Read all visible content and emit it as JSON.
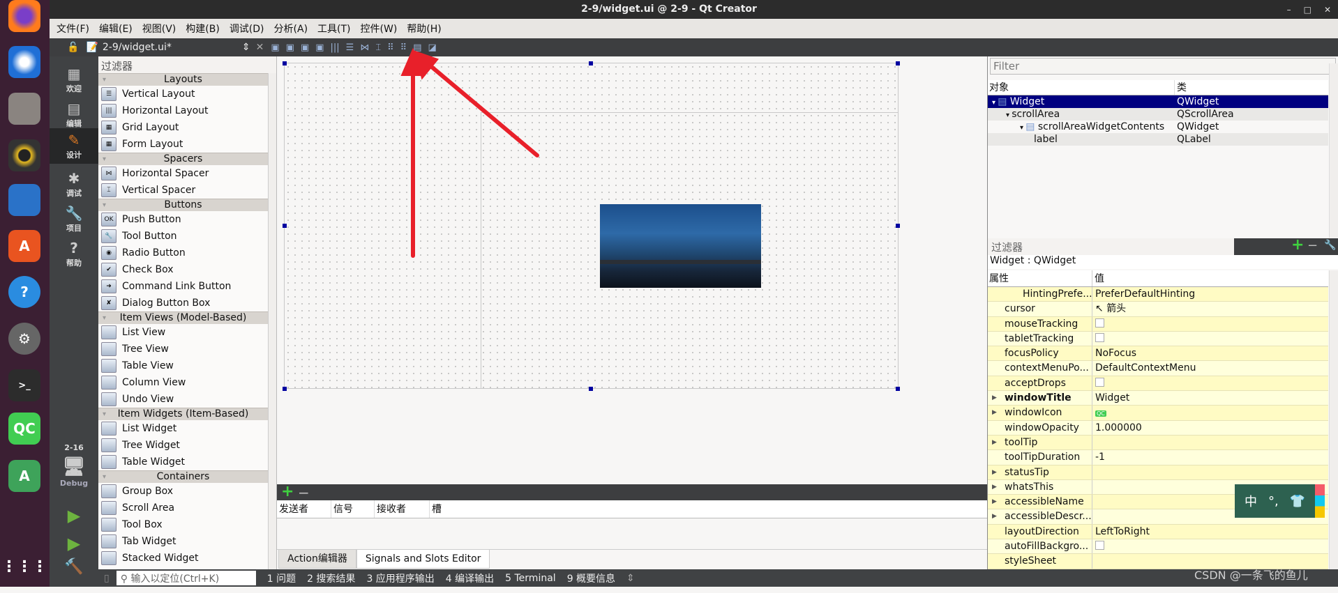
{
  "window": {
    "title": "2-9/widget.ui @ 2-9 - Qt Creator",
    "controls": [
      "–",
      "□",
      "✕"
    ]
  },
  "menu": [
    "文件(F)",
    "编辑(E)",
    "视图(V)",
    "构建(B)",
    "调试(D)",
    "分析(A)",
    "工具(T)",
    "控件(W)",
    "帮助(H)"
  ],
  "toolbar": {
    "file": "2-9/widget.ui*",
    "close": "✕"
  },
  "modes": [
    {
      "label": "欢迎",
      "icon": "▦"
    },
    {
      "label": "编辑",
      "icon": "▤"
    },
    {
      "label": "设计",
      "icon": "✎"
    },
    {
      "label": "调试",
      "icon": "✱"
    },
    {
      "label": "项目",
      "icon": "🔧"
    },
    {
      "label": "帮助",
      "icon": "?"
    }
  ],
  "kit": {
    "project": "2-16",
    "config": "Debug"
  },
  "widgetbox": {
    "filter": "过滤器",
    "categories": [
      {
        "name": "Layouts",
        "items": [
          "Vertical Layout",
          "Horizontal Layout",
          "Grid Layout",
          "Form Layout"
        ]
      },
      {
        "name": "Spacers",
        "items": [
          "Horizontal Spacer",
          "Vertical Spacer"
        ]
      },
      {
        "name": "Buttons",
        "items": [
          "Push Button",
          "Tool Button",
          "Radio Button",
          "Check Box",
          "Command Link Button",
          "Dialog Button Box"
        ]
      },
      {
        "name": "Item Views (Model-Based)",
        "items": [
          "List View",
          "Tree View",
          "Table View",
          "Column View",
          "Undo View"
        ]
      },
      {
        "name": "Item Widgets (Item-Based)",
        "items": [
          "List Widget",
          "Tree Widget",
          "Table Widget"
        ]
      },
      {
        "name": "Containers",
        "items": [
          "Group Box",
          "Scroll Area",
          "Tool Box",
          "Tab Widget",
          "Stacked Widget"
        ]
      }
    ]
  },
  "signals": {
    "columns": [
      "发送者",
      "信号",
      "接收者",
      "槽"
    ],
    "tabs": [
      "Action编辑器",
      "Signals and Slots Editor"
    ]
  },
  "objects": {
    "filter": "Filter",
    "columns": [
      "对象",
      "类"
    ],
    "rows": [
      {
        "name": "Widget",
        "class": "QWidget",
        "depth": 0,
        "selected": true
      },
      {
        "name": "scrollArea",
        "class": "QScrollArea",
        "depth": 1
      },
      {
        "name": "scrollAreaWidgetContents",
        "class": "QWidget",
        "depth": 2
      },
      {
        "name": "label",
        "class": "QLabel",
        "depth": 3
      }
    ]
  },
  "properties": {
    "filter": "过滤器",
    "object": "Widget : QWidget",
    "columns": [
      "属性",
      "值"
    ],
    "rows": [
      {
        "name": "HintingPrefe...",
        "value": "PreferDefaultHinting"
      },
      {
        "name": "cursor",
        "value": "箭头"
      },
      {
        "name": "mouseTracking",
        "value": "",
        "checkbox": true
      },
      {
        "name": "tabletTracking",
        "value": "",
        "checkbox": true
      },
      {
        "name": "focusPolicy",
        "value": "NoFocus"
      },
      {
        "name": "contextMenuPo...",
        "value": "DefaultContextMenu"
      },
      {
        "name": "acceptDrops",
        "value": "",
        "checkbox": true
      },
      {
        "name": "windowTitle",
        "value": "Widget",
        "expandable": true,
        "bold": true
      },
      {
        "name": "windowIcon",
        "value": "QC",
        "expandable": true
      },
      {
        "name": "windowOpacity",
        "value": "1.000000"
      },
      {
        "name": "toolTip",
        "value": "",
        "expandable": true
      },
      {
        "name": "toolTipDuration",
        "value": "-1"
      },
      {
        "name": "statusTip",
        "value": "",
        "expandable": true
      },
      {
        "name": "whatsThis",
        "value": "",
        "expandable": true
      },
      {
        "name": "accessibleName",
        "value": "",
        "expandable": true
      },
      {
        "name": "accessibleDescr...",
        "value": "",
        "expandable": true
      },
      {
        "name": "layoutDirection",
        "value": "LeftToRight"
      },
      {
        "name": "autoFillBackgro...",
        "value": "",
        "checkbox": true
      },
      {
        "name": "styleSheet",
        "value": ""
      }
    ]
  },
  "statusbar": {
    "locator_placeholder": "输入以定位(Ctrl+K)",
    "panes": [
      "1 问题",
      "2 搜索结果",
      "3 应用程序输出",
      "4 编译输出",
      "5 Terminal",
      "9 概要信息"
    ]
  },
  "ime": {
    "mode": "中",
    "punct": "°,",
    "skin": "👕"
  },
  "watermark": "CSDN @一条飞的鱼儿",
  "colors": {
    "selection": "#000080",
    "property_row": "#ffffc8",
    "annotation_arrow": "#e8202a"
  }
}
